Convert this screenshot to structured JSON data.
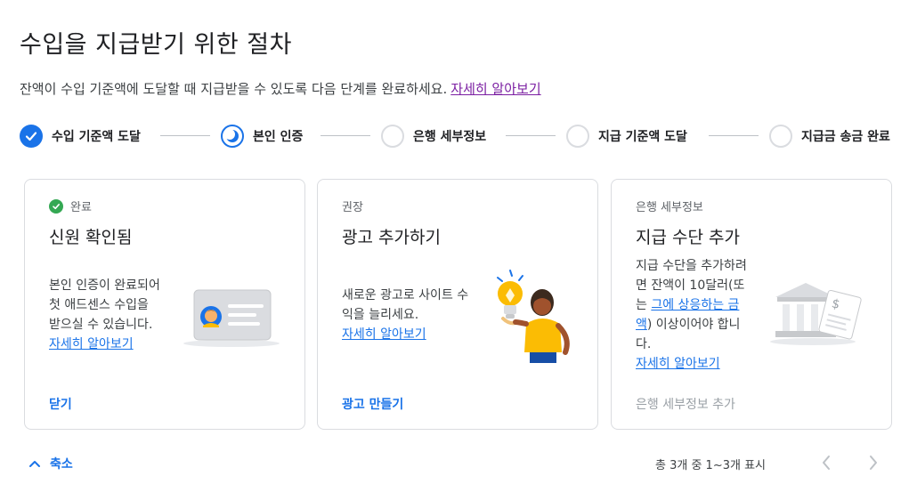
{
  "header": {
    "title": "수입을 지급받기 위한 절차",
    "subtitle": "잔액이 수입 기준액에 도달할 때 지급받을 수 있도록 다음 단계를 완료하세요.",
    "learn_more": "자세히 알아보기"
  },
  "steps": [
    {
      "label": "수입 기준액 도달",
      "state": "done"
    },
    {
      "label": "본인 인증",
      "state": "in-progress"
    },
    {
      "label": "은행 세부정보",
      "state": "todo"
    },
    {
      "label": "지급 기준액 도달",
      "state": "todo"
    },
    {
      "label": "지급금 송금 완료",
      "state": "todo"
    }
  ],
  "cards": [
    {
      "tag": "완료",
      "tag_icon": "check-circle-icon",
      "title": "신원 확인됨",
      "body_lines": [
        "본인 인증이 완료되어",
        "첫 애드센스 수입을",
        "받으실 수 있습니다."
      ],
      "link": "자세히 알아보기",
      "action": "닫기",
      "illustration": "id-card-illustration"
    },
    {
      "tag": "권장",
      "title": "광고 추가하기",
      "body_lines": [
        "새로운 광고로 사이트 수",
        "익을 늘리세요."
      ],
      "link": "자세히 알아보기",
      "action": "광고 만들기",
      "illustration": "lightbulb-person-illustration"
    },
    {
      "tag": "은행 세부정보",
      "title": "지급 수단 추가",
      "body_parts": {
        "line1": "지급 수단을 추가하려",
        "line2": "면 잔액이 10달러(또",
        "line3_prefix": "는 ",
        "line3_link": "그에 상응하는 금",
        "line4_link": "액",
        "line4_suffix": ") 이상이어야 합니",
        "line5": "다."
      },
      "link": "자세히 알아보기",
      "action": "은행 세부정보 추가",
      "action_state": "disabled",
      "illustration": "bank-check-illustration"
    }
  ],
  "footer": {
    "collapse_label": "축소",
    "pagination": "총 3개 중 1~3개 표시",
    "prev_icon": "chevron-left-icon",
    "next_icon": "chevron-right-icon"
  },
  "colors": {
    "accent": "#1a73e8",
    "success": "#34a853",
    "visited_link": "#7b1fa2",
    "border": "#dadce0"
  }
}
